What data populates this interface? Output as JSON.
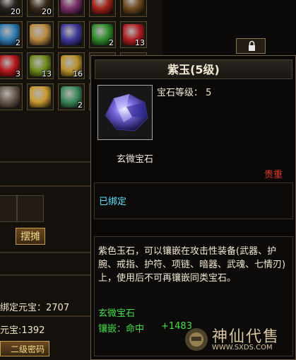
{
  "inventory": {
    "slots": [
      {
        "count": "20",
        "color": "#2a2520"
      },
      {
        "count": "20",
        "color": "#3a2c1c"
      },
      {
        "count": "",
        "color": "#7a2e6a"
      },
      {
        "count": "",
        "color": "#a3221b"
      },
      {
        "count": "",
        "color": "#6d4a1e"
      },
      {
        "count": "2",
        "color": "#2f7bb0"
      },
      {
        "count": "",
        "color": "#b98a42"
      },
      {
        "count": "",
        "color": "#3f3a9a"
      },
      {
        "count": "2",
        "color": "#2f8a2a"
      },
      {
        "count": "13",
        "color": "#b01f22"
      },
      {
        "count": "3",
        "color": "#b5171c"
      },
      {
        "count": "13",
        "color": "#6e8a1c"
      },
      {
        "count": "16",
        "color": "#b8902a"
      },
      {
        "count": "",
        "color": "#14100c"
      },
      {
        "count": "",
        "color": "#14100c"
      },
      {
        "count": "",
        "color": "#6a5a4e"
      },
      {
        "count": "",
        "color": "#c89a32"
      },
      {
        "count": "2",
        "color": "#3a8a5a"
      },
      {
        "count": "",
        "color": "#14100c"
      },
      {
        "count": "",
        "color": "#14100c"
      }
    ],
    "stall_label": "摆摊",
    "bound_yuanbao": "绑定元宝：2707",
    "yuanbao": "元宝:1392",
    "password_label": "二级密码"
  },
  "tooltip": {
    "title": "紫玉(5级)",
    "gem_level": "宝石等级： 5",
    "gem_type": "玄微宝石",
    "valuable": "贵重",
    "bound": "已绑定",
    "description": "紫色玉石，可以镶嵌在攻击性装备(武器、护腕、戒指、护符、项链、暗器、武魂、七情刃)上，使用后不可再镶嵌同类宝石。",
    "gem_type2": "玄微宝石",
    "inlay_label": "镶嵌：命中",
    "inlay_value": "+1483"
  },
  "watermark": {
    "text": "神仙代售",
    "url": "WWW.SXDS.COM"
  },
  "colors": {
    "valuable": "#e03a2a",
    "bound": "#60e0ff",
    "green": "#45e04a"
  }
}
